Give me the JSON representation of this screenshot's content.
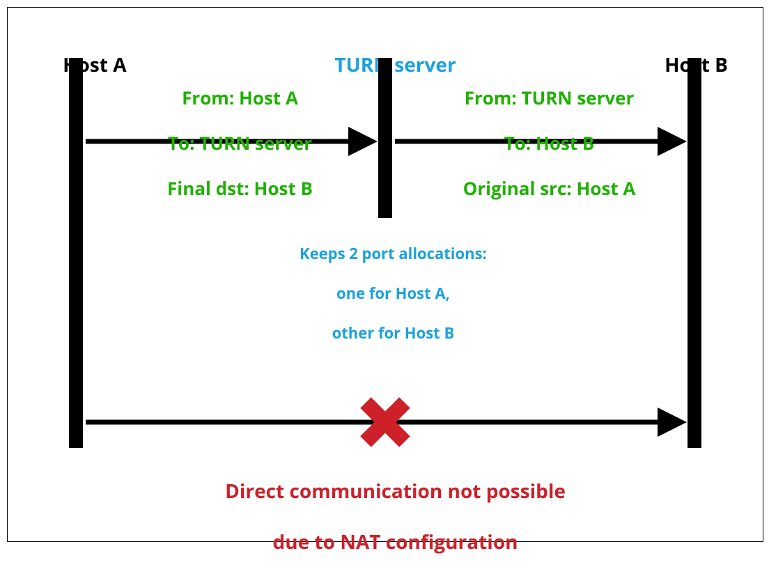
{
  "header": {
    "hostA": "Host A",
    "turn": "TURN server",
    "hostB": "Host B"
  },
  "msgLeft": {
    "line1": "From: Host A",
    "line2": "To: TURN server",
    "line3": "Final dst: Host B"
  },
  "msgRight": {
    "line1": "From: TURN server",
    "line2": "To: Host B",
    "line3": "Original src: Host A"
  },
  "turnNote": {
    "line1": "Keeps 2 port allocations:",
    "line2": "one for Host A,",
    "line3": "other for Host B"
  },
  "bottomNote": {
    "line1": "Direct communication not possible",
    "line2": "due to NAT configuration"
  },
  "colors": {
    "blue": "#1AA2DE",
    "green": "#1EB100",
    "red": "#CE2029",
    "black": "#000000"
  }
}
